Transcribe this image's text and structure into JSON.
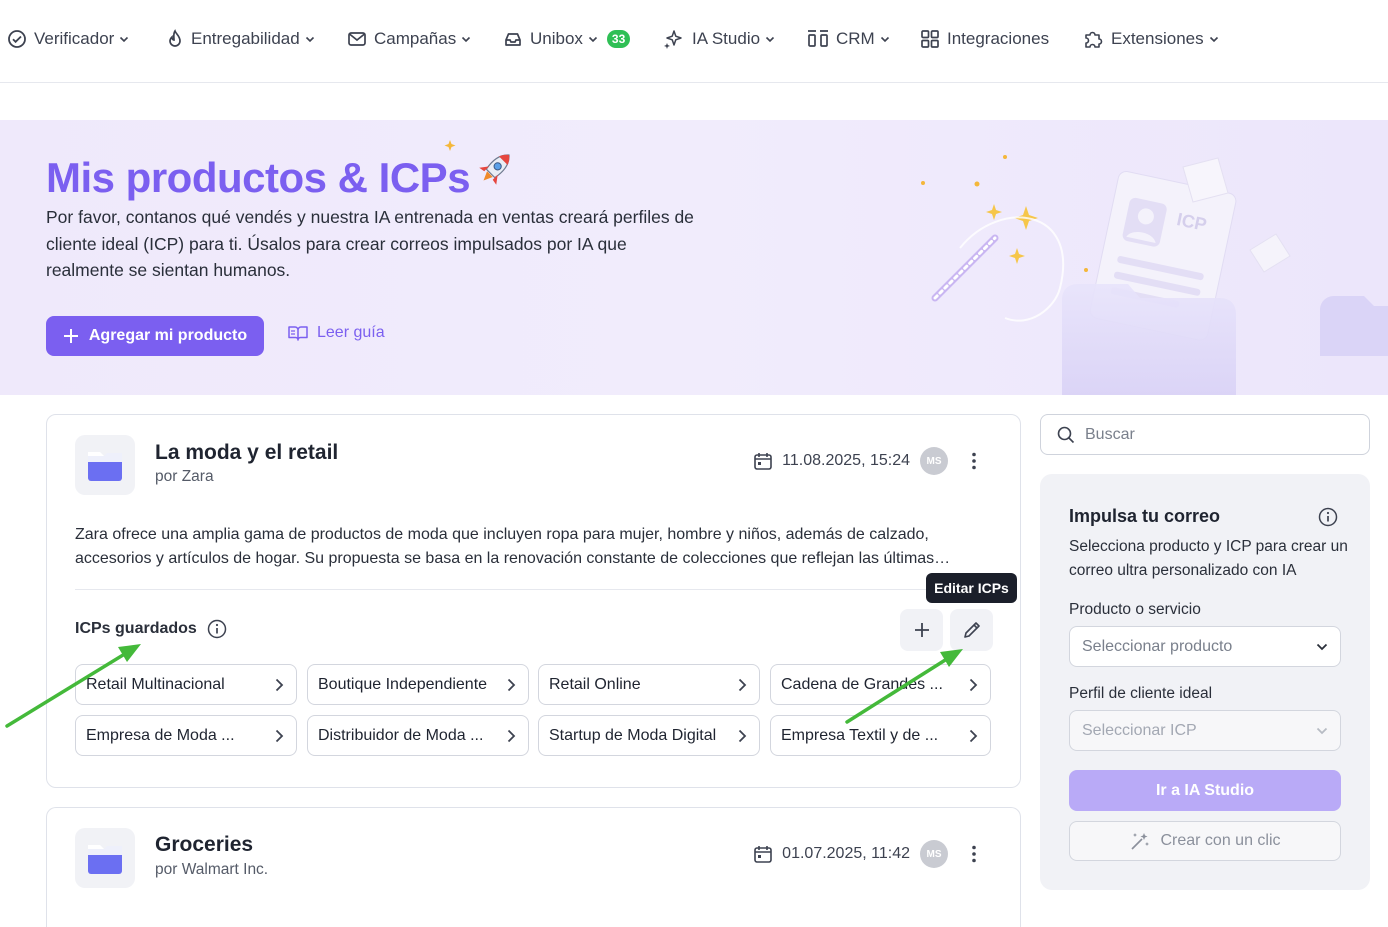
{
  "nav": {
    "items": [
      {
        "label": "Verificador",
        "icon": "check-circle-icon"
      },
      {
        "label": "Entregabilidad",
        "icon": "flame-icon"
      },
      {
        "label": "Campañas",
        "icon": "mail-icon"
      },
      {
        "label": "Unibox",
        "icon": "inbox-icon",
        "badge": "33"
      },
      {
        "label": "IA Studio",
        "icon": "sparkle-icon"
      },
      {
        "label": "CRM",
        "icon": "crm-icon"
      },
      {
        "label": "Integraciones",
        "icon": "grid-icon"
      },
      {
        "label": "Extensiones",
        "icon": "puzzle-icon"
      }
    ]
  },
  "hero": {
    "title": "Mis productos & ICPs",
    "description": "Por favor, contanos qué vendés y nuestra IA entrenada en ventas creará perfiles de cliente ideal (ICP) para ti. Úsalos para crear correos impulsados por IA que realmente se sientan humanos.",
    "add_button": "Agregar mi producto",
    "guide_link": "Leer guía",
    "illustration_label": "ICP"
  },
  "products": [
    {
      "title": "La moda y el retail",
      "by": "por Zara",
      "date": "11.08.2025, 15:24",
      "avatar": "MS",
      "description": "Zara ofrece una amplia gama de productos de moda que incluyen ropa para mujer, hombre y niños, además de calzado, accesorios y artículos de hogar. Su propuesta se basa en la renovación constante de colecciones que reflejan las últimas…",
      "icps_label": "ICPs guardados",
      "edit_tooltip": "Editar ICPs",
      "icps": [
        "Retail Multinacional",
        "Boutique Independiente",
        "Retail Online",
        "Cadena de Grandes ...",
        "Empresa de Moda ...",
        "Distribuidor de Moda ...",
        "Startup de Moda Digital",
        "Empresa Textil y de ..."
      ]
    },
    {
      "title": "Groceries",
      "by": "por Walmart Inc.",
      "date": "01.07.2025, 11:42",
      "avatar": "MS"
    }
  ],
  "sidebar": {
    "search_placeholder": "Buscar",
    "title": "Impulsa tu correo",
    "description": "Selecciona producto y ICP para crear un correo ultra personalizado con IA",
    "product_label": "Producto o servicio",
    "product_placeholder": "Seleccionar producto",
    "icp_label": "Perfil de cliente ideal",
    "icp_placeholder": "Seleccionar ICP",
    "go_button": "Ir a IA Studio",
    "quick_button": "Crear con un clic"
  },
  "colors": {
    "accent": "#7b5ff0",
    "badge_green": "#2fbf55",
    "annotation_arrow": "#44b93a"
  }
}
